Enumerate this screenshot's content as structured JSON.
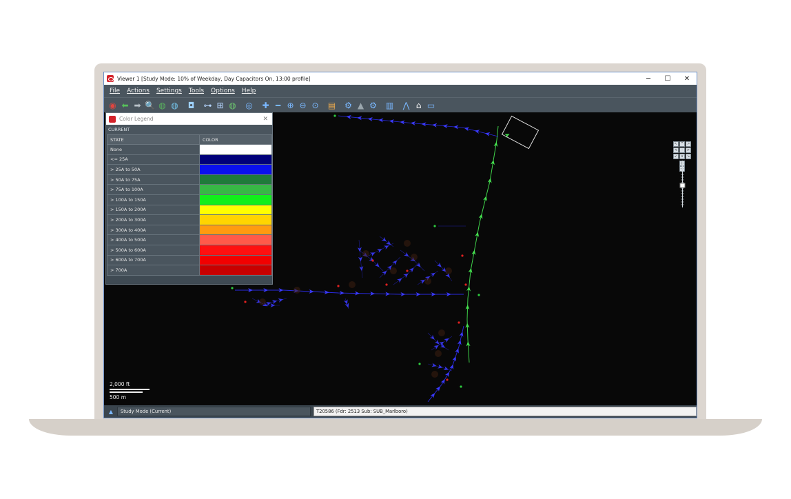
{
  "window": {
    "title": "Viewer 1 [Study Mode: 10% of Weekday, Day Capacitors On, 13:00 profile]",
    "controls": [
      "─",
      "☐",
      "✕"
    ]
  },
  "menu": [
    "File",
    "Actions",
    "Settings",
    "Tools",
    "Options",
    "Help"
  ],
  "toolbar_icons": [
    {
      "name": "target-icon",
      "glyph": "◉",
      "color": "#e0453f"
    },
    {
      "name": "back-arrow-icon",
      "glyph": "⬅",
      "color": "#57c15a"
    },
    {
      "name": "forward-arrow-icon",
      "glyph": "➡",
      "color": "#b9c2c9"
    },
    {
      "name": "magnifier-icon",
      "glyph": "🔍",
      "color": "#9cd0ff"
    },
    {
      "name": "globe-search-icon",
      "glyph": "◍",
      "color": "#5ab55e"
    },
    {
      "name": "globe-refresh-icon",
      "glyph": "◍",
      "color": "#74c2e8"
    },
    {
      "name": "camera-icon",
      "glyph": "◘",
      "color": "#9fd2ff"
    },
    {
      "name": "connector-icon",
      "glyph": "⊶",
      "color": "#b5d5ff"
    },
    {
      "name": "network-icon",
      "glyph": "⊞",
      "color": "#b5d5ff"
    },
    {
      "name": "globe-icon",
      "glyph": "◍",
      "color": "#6cc46e"
    },
    {
      "name": "hide-eye-icon",
      "glyph": "◎",
      "color": "#7ab8ff"
    },
    {
      "name": "zoom-in-abc-icon",
      "glyph": "✚",
      "color": "#7ab8ff"
    },
    {
      "name": "zoom-out-abc-icon",
      "glyph": "━",
      "color": "#7ab8ff"
    },
    {
      "name": "zoom-in-icon",
      "glyph": "⊕",
      "color": "#7ab8ff"
    },
    {
      "name": "zoom-out-icon",
      "glyph": "⊖",
      "color": "#7ab8ff"
    },
    {
      "name": "zoom-extent-icon",
      "glyph": "⊙",
      "color": "#7ab8ff"
    },
    {
      "name": "layers-icon",
      "glyph": "▤",
      "color": "#e9a94e"
    },
    {
      "name": "gear-icon",
      "glyph": "⚙",
      "color": "#7ab8ff"
    },
    {
      "name": "graduation-cap-icon",
      "glyph": "▲",
      "color": "#9aa6ad"
    },
    {
      "name": "settings-gear-icon",
      "glyph": "⚙",
      "color": "#7ab8ff"
    },
    {
      "name": "document-icon",
      "glyph": "▥",
      "color": "#7ab8ff"
    },
    {
      "name": "tree-icon",
      "glyph": "⋀",
      "color": "#7ab8ff"
    },
    {
      "name": "home-icon",
      "glyph": "⌂",
      "color": "#ffffff"
    },
    {
      "name": "comment-icon",
      "glyph": "▭",
      "color": "#7ab8ff"
    }
  ],
  "legend": {
    "title": "Color Legend",
    "section": "CURRENT",
    "headers": [
      "STATE",
      "COLOR"
    ],
    "rows": [
      {
        "state": "None",
        "color": "#ffffff"
      },
      {
        "state": "<= 25A",
        "color": "#00007a"
      },
      {
        "state": "> 25A to 50A",
        "color": "#0a10ee"
      },
      {
        "state": "> 50A to 75A",
        "color": "#1f7a3a"
      },
      {
        "state": "> 75A to 100A",
        "color": "#37b845"
      },
      {
        "state": "> 100A to 150A",
        "color": "#12ef1b"
      },
      {
        "state": "> 150A to 200A",
        "color": "#ffff00"
      },
      {
        "state": "> 200A to 300A",
        "color": "#ffd400"
      },
      {
        "state": "> 300A to 400A",
        "color": "#ff9a10"
      },
      {
        "state": "> 400A to 500A",
        "color": "#ff5a4a"
      },
      {
        "state": "> 500A to 600A",
        "color": "#ff1010"
      },
      {
        "state": "> 600A to 700A",
        "color": "#f20000"
      },
      {
        "state": "> 700A",
        "color": "#c80000"
      }
    ]
  },
  "scale": {
    "imperial": "2,000 ft",
    "metric": "500 m"
  },
  "status": {
    "mode": "Study Mode (Current)",
    "info": "T20586 (Fdr: 2513 Sub: SUB_Marlboro)"
  }
}
